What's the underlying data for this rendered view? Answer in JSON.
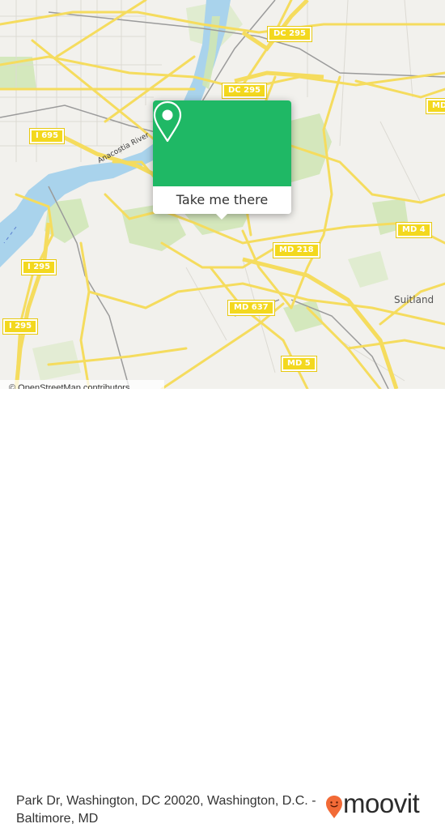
{
  "map": {
    "highway_shields": [
      {
        "id": "dc295-top",
        "label": "DC 295"
      },
      {
        "id": "dc295-mid",
        "label": "DC 295"
      },
      {
        "id": "md-right-edge",
        "label": "MD"
      },
      {
        "id": "i695",
        "label": "I 695"
      },
      {
        "id": "i295-upper",
        "label": "I 295"
      },
      {
        "id": "i295-lower",
        "label": "I 295"
      },
      {
        "id": "md4",
        "label": "MD 4"
      },
      {
        "id": "md218",
        "label": "MD 218"
      },
      {
        "id": "md637",
        "label": "MD 637"
      },
      {
        "id": "md5",
        "label": "MD 5"
      }
    ],
    "river_label": "Anacostia River",
    "place_label": "Suitland",
    "attribution": "© OpenStreetMap contributors",
    "colors": {
      "land": "#f2f1ed",
      "water": "#a9d3ec",
      "park": "#cde5b0",
      "road": "#f7e065",
      "shield": "#f3d81e"
    }
  },
  "popup": {
    "icon": "map-pin-icon",
    "button_label": "Take me there",
    "accent_color": "#1fb865"
  },
  "footer": {
    "address": "Park Dr, Washington, DC 20020, Washington, D.C. - Baltimore, MD",
    "logo_text": "moovit",
    "logo_color": "#f26a36"
  }
}
